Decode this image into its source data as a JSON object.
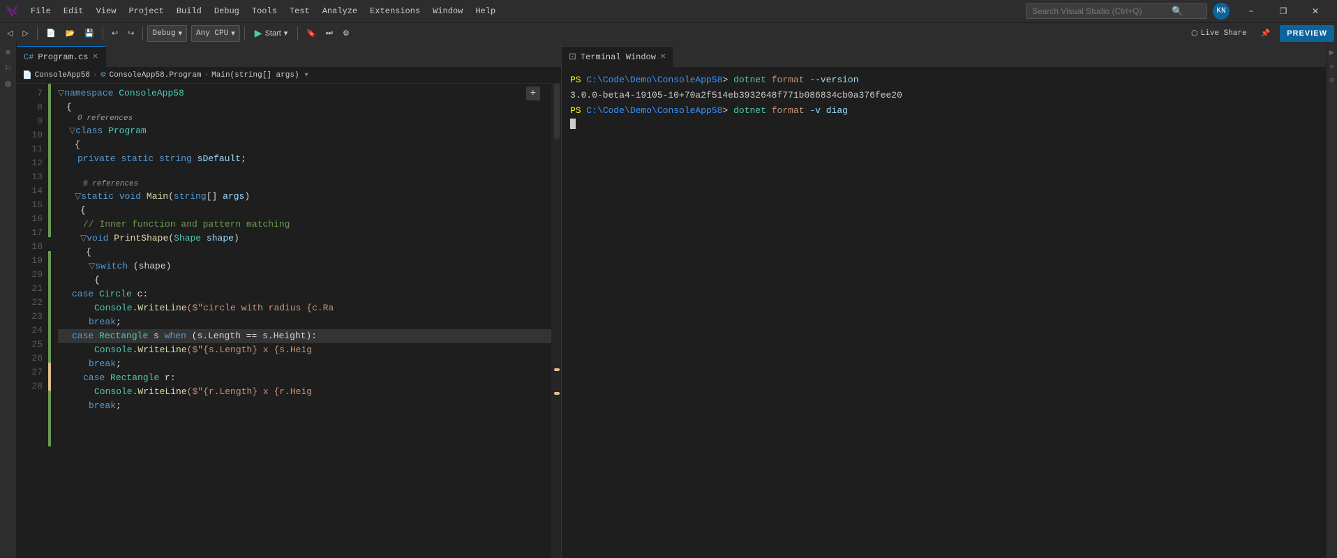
{
  "titleBar": {
    "menus": [
      "File",
      "Edit",
      "View",
      "Project",
      "Build",
      "Debug",
      "Tools",
      "Test",
      "Analyze",
      "Extensions",
      "Window",
      "Help"
    ],
    "searchPlaceholder": "Search Visual Studio (Ctrl+Q)",
    "userInitials": "KN",
    "winButtons": [
      "−",
      "❐",
      "✕"
    ]
  },
  "toolbar": {
    "debugConfig": "Debug",
    "platform": "Any CPU",
    "startLabel": "Start",
    "liveShareLabel": "Live Share",
    "previewLabel": "PREVIEW"
  },
  "editor": {
    "tabLabel": "Program.cs",
    "breadcrumbs": [
      "ConsoleApp58",
      "ConsoleApp58.Program",
      "Main(string[] args)"
    ],
    "lines": [
      {
        "num": 7,
        "indent": 0,
        "tokens": [
          {
            "t": "namespace",
            "c": "kw"
          },
          {
            "t": " ConsoleApp58",
            "c": "ns"
          }
        ],
        "gutter": "green",
        "collapse": true
      },
      {
        "num": 8,
        "indent": 4,
        "tokens": [
          {
            "t": "{",
            "c": "plain"
          }
        ],
        "gutter": "green"
      },
      {
        "num": 9,
        "indent": 8,
        "tokens": [
          {
            "t": "class",
            "c": "kw"
          },
          {
            "t": " Program",
            "c": "type"
          }
        ],
        "gutter": "green",
        "refCount": "0 references",
        "collapse": true
      },
      {
        "num": 10,
        "indent": 12,
        "tokens": [
          {
            "t": "{",
            "c": "plain"
          }
        ],
        "gutter": "green"
      },
      {
        "num": 11,
        "indent": 16,
        "tokens": [
          {
            "t": "private",
            "c": "kw"
          },
          {
            "t": " static",
            "c": "kw"
          },
          {
            "t": " string",
            "c": "kw"
          },
          {
            "t": " sDefault",
            "c": "var"
          },
          {
            "t": ";",
            "c": "plain"
          }
        ],
        "gutter": "green"
      },
      {
        "num": 12,
        "indent": 0,
        "tokens": [],
        "gutter": "none"
      },
      {
        "num": 13,
        "indent": 16,
        "tokens": [
          {
            "t": "static",
            "c": "kw"
          },
          {
            "t": " void",
            "c": "kw"
          },
          {
            "t": " Main",
            "c": "method"
          },
          {
            "t": "(",
            "c": "plain"
          },
          {
            "t": "string",
            "c": "kw"
          },
          {
            "t": "[]",
            "c": "plain"
          },
          {
            "t": " args",
            "c": "var"
          },
          {
            "t": ")",
            "c": "plain"
          }
        ],
        "gutter": "green",
        "refCount": "0 references",
        "collapse": true
      },
      {
        "num": 14,
        "indent": 20,
        "tokens": [
          {
            "t": "{",
            "c": "plain"
          }
        ],
        "gutter": "green"
      },
      {
        "num": 15,
        "indent": 24,
        "tokens": [
          {
            "t": "// Inner function and pattern matching",
            "c": "comment"
          }
        ],
        "gutter": "green"
      },
      {
        "num": 16,
        "indent": 24,
        "tokens": [
          {
            "t": "void",
            "c": "kw"
          },
          {
            "t": " PrintShape",
            "c": "method"
          },
          {
            "t": "(",
            "c": "plain"
          },
          {
            "t": "Shape",
            "c": "type"
          },
          {
            "t": " shape",
            "c": "var"
          },
          {
            "t": ")",
            "c": "plain"
          }
        ],
        "gutter": "green",
        "collapse": true
      },
      {
        "num": 17,
        "indent": 28,
        "tokens": [
          {
            "t": "{",
            "c": "plain"
          }
        ],
        "gutter": "green"
      },
      {
        "num": 18,
        "indent": 32,
        "tokens": [
          {
            "t": "switch",
            "c": "kw"
          },
          {
            "t": " (shape)",
            "c": "plain"
          }
        ],
        "gutter": "green",
        "collapse": true
      },
      {
        "num": 19,
        "indent": 36,
        "tokens": [
          {
            "t": "{",
            "c": "plain"
          }
        ],
        "gutter": "green"
      },
      {
        "num": 20,
        "indent": 20,
        "tokens": [
          {
            "t": "case",
            "c": "kw"
          },
          {
            "t": " Circle",
            "c": "type"
          },
          {
            "t": " c:",
            "c": "plain"
          }
        ],
        "gutter": "green"
      },
      {
        "num": 21,
        "indent": 36,
        "tokens": [
          {
            "t": "Console",
            "c": "type"
          },
          {
            "t": ".",
            "c": "plain"
          },
          {
            "t": "WriteLine",
            "c": "method"
          },
          {
            "t": "($\"circle with radius {c.Ra",
            "c": "str"
          }
        ],
        "gutter": "green"
      },
      {
        "num": 22,
        "indent": 32,
        "tokens": [
          {
            "t": "break",
            "c": "kw"
          },
          {
            "t": ";",
            "c": "plain"
          }
        ],
        "gutter": "green"
      },
      {
        "num": 23,
        "indent": 20,
        "tokens": [
          {
            "t": "case",
            "c": "kw"
          },
          {
            "t": " Rectangle",
            "c": "type"
          },
          {
            "t": " s ",
            "c": "plain"
          },
          {
            "t": "when",
            "c": "kw"
          },
          {
            "t": " (s.Length == s.Height):",
            "c": "plain"
          }
        ],
        "gutter": "yellow",
        "scrollIndicator": true
      },
      {
        "num": 24,
        "indent": 36,
        "tokens": [
          {
            "t": "Console",
            "c": "type"
          },
          {
            "t": ".",
            "c": "plain"
          },
          {
            "t": "WriteLine",
            "c": "method"
          },
          {
            "t": "($\"{s.Length} x {s.Heig",
            "c": "str"
          }
        ],
        "gutter": "yellow"
      },
      {
        "num": 25,
        "indent": 32,
        "tokens": [
          {
            "t": "break",
            "c": "kw"
          },
          {
            "t": ";",
            "c": "plain"
          }
        ],
        "gutter": "green"
      },
      {
        "num": 26,
        "indent": 28,
        "tokens": [
          {
            "t": "case",
            "c": "kw"
          },
          {
            "t": " Rectangle",
            "c": "type"
          },
          {
            "t": " r:",
            "c": "plain"
          }
        ],
        "gutter": "green"
      },
      {
        "num": 27,
        "indent": 36,
        "tokens": [
          {
            "t": "Console",
            "c": "type"
          },
          {
            "t": ".",
            "c": "plain"
          },
          {
            "t": "WriteLine",
            "c": "method"
          },
          {
            "t": "($\"{r.Length} x {r.Heig",
            "c": "str"
          }
        ],
        "gutter": "green"
      },
      {
        "num": 28,
        "indent": 32,
        "tokens": [
          {
            "t": "break",
            "c": "kw"
          },
          {
            "t": ";",
            "c": "plain"
          }
        ],
        "gutter": "green"
      }
    ]
  },
  "terminal": {
    "tabLabel": "Terminal Window",
    "lines": [
      {
        "type": "command",
        "ps": "PS",
        "path": "C:\\Code\\Demo\\ConsoleApp58",
        "gt": ">",
        "cmd": "dotnet",
        "args": [
          "format",
          "--version"
        ]
      },
      {
        "type": "output",
        "text": "3.0.0-beta4-19105-10+70a2f514eb3932648f771b086834cb0a376fee20"
      },
      {
        "type": "command",
        "ps": "PS",
        "path": "C:\\Code\\Demo\\ConsoleApp58",
        "gt": ">",
        "cmd": "dotnet",
        "args": [
          "format",
          "-v",
          "diag"
        ],
        "hasCursor": true
      }
    ]
  }
}
